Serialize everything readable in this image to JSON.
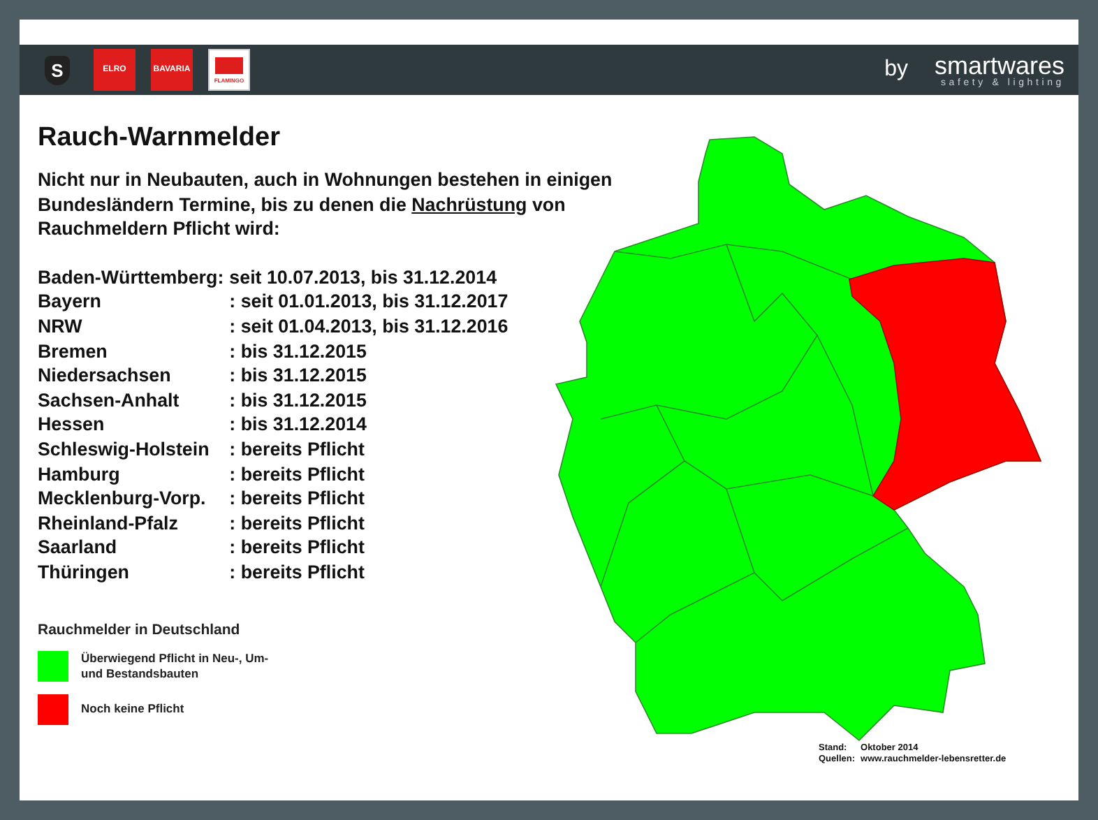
{
  "header": {
    "brands": [
      {
        "kind": "shield",
        "text": "S"
      },
      {
        "kind": "red",
        "text": "ELRO"
      },
      {
        "kind": "red",
        "text": "BAVARIA"
      },
      {
        "kind": "flag",
        "text": "FLAMINGO"
      }
    ],
    "by": "by",
    "company": "smartwares",
    "tagline": "safety & lighting"
  },
  "title": "Rauch-Warnmelder",
  "intro": {
    "before": "Nicht nur in Neubauten, auch in Wohnungen bestehen in einigen Bundesländern Termine, bis zu denen die ",
    "underlined": "Nachrüstung",
    "after": " von Rauchmeldern Pflicht wird:"
  },
  "states": [
    {
      "name": "Baden-Württemberg:",
      "value": "seit 10.07.2013, bis 31.12.2014"
    },
    {
      "name": "Bayern",
      "value": ": seit 01.01.2013, bis 31.12.2017"
    },
    {
      "name": "NRW",
      "value": ": seit 01.04.2013, bis 31.12.2016"
    },
    {
      "name": "Bremen",
      "value": ": bis 31.12.2015"
    },
    {
      "name": "Niedersachsen",
      "value": ": bis 31.12.2015"
    },
    {
      "name": "Sachsen-Anhalt",
      "value": ": bis 31.12.2015"
    },
    {
      "name": "Hessen",
      "value": ": bis 31.12.2014"
    },
    {
      "name": "Schleswig-Holstein",
      "value": ": bereits Pflicht"
    },
    {
      "name": "Hamburg",
      "value": ": bereits Pflicht"
    },
    {
      "name": "Mecklenburg-Vorp.",
      "value": ": bereits Pflicht"
    },
    {
      "name": "Rheinland-Pfalz",
      "value": ": bereits Pflicht"
    },
    {
      "name": "Saarland",
      "value": ": bereits Pflicht"
    },
    {
      "name": "Thüringen",
      "value": ": bereits Pflicht"
    }
  ],
  "legend": {
    "title": "Rauchmelder in Deutschland",
    "items": [
      {
        "label": "Überwiegend Pflicht in Neu-, Um- und Bestandsbauten",
        "color": "#00ff00"
      },
      {
        "label": "Noch keine Pflicht",
        "color": "#ff0000"
      }
    ]
  },
  "source": {
    "date_label": "Stand:",
    "date": "Oktober 2014",
    "sources_label": "Quellen:",
    "sources": "www.rauchmelder-lebensretter.de"
  }
}
